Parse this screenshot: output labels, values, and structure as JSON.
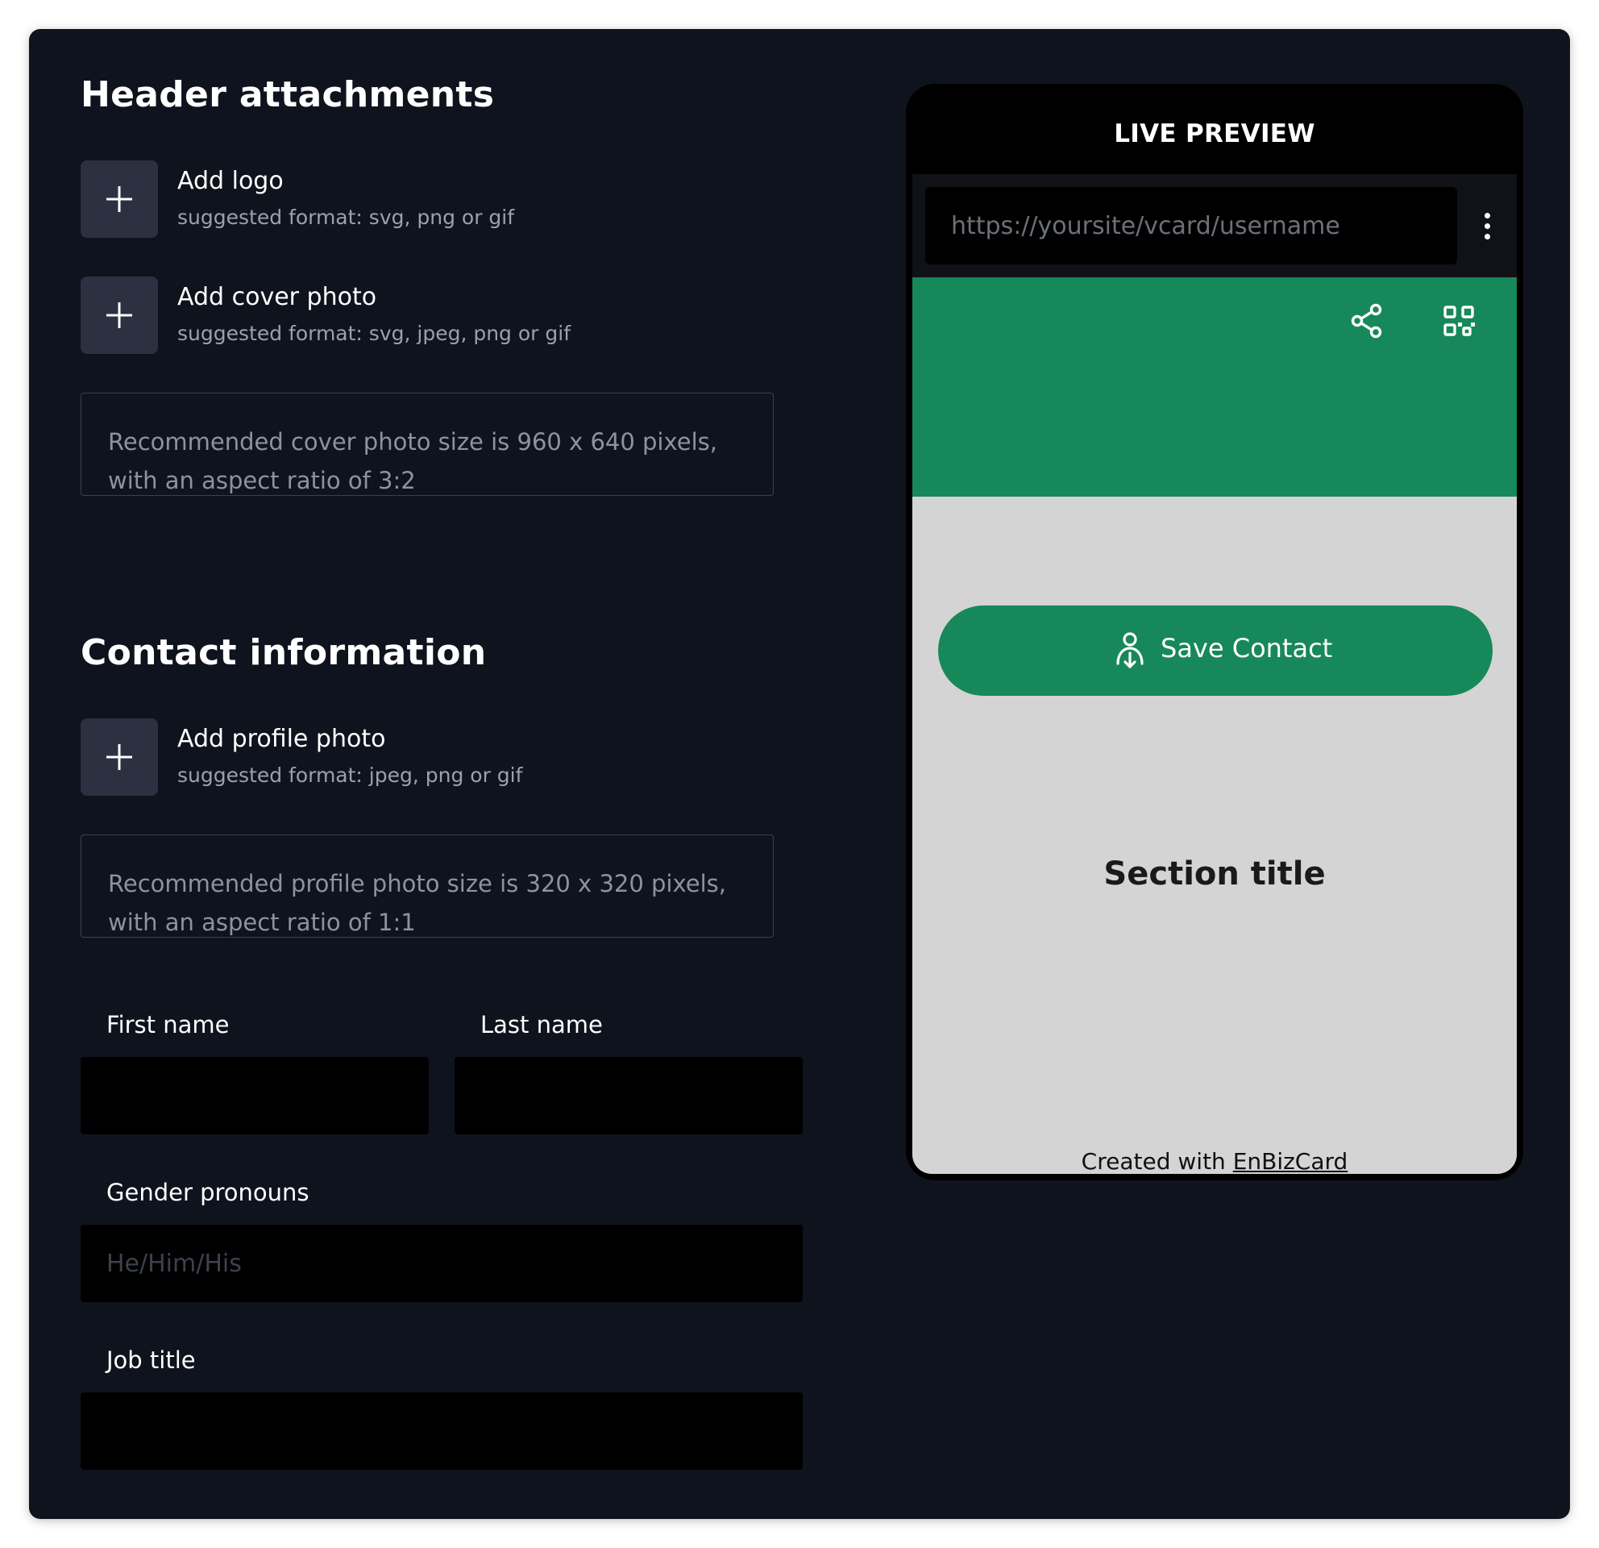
{
  "header_attachments": {
    "title": "Header attachments",
    "logo": {
      "label": "Add logo",
      "hint": "suggested format: svg, png or gif"
    },
    "cover": {
      "label": "Add cover photo",
      "hint": "suggested format: svg, jpeg, png or gif"
    },
    "cover_note": "Recommended cover photo size is 960 x 640 pixels, with an aspect ratio of 3:2"
  },
  "contact_information": {
    "title": "Contact information",
    "profile": {
      "label": "Add profile photo",
      "hint": "suggested format: jpeg, png or gif"
    },
    "profile_note": "Recommended profile photo size is 320 x 320 pixels, with an aspect ratio of 1:1",
    "first_name": {
      "label": "First name",
      "value": ""
    },
    "last_name": {
      "label": "Last name",
      "value": ""
    },
    "gender_pronouns": {
      "label": "Gender pronouns",
      "placeholder": "He/Him/His",
      "value": ""
    },
    "job_title": {
      "label": "Job title",
      "value": ""
    }
  },
  "preview": {
    "title": "LIVE PREVIEW",
    "url_placeholder": "https://yoursite/vcard/username",
    "save_contact": "Save Contact",
    "section_title": "Section title",
    "credit_prefix": "Created with ",
    "credit_link": "EnBizCard",
    "icons": [
      "share-icon",
      "qr-code-icon",
      "more-vertical-icon",
      "contact-download-icon"
    ]
  },
  "colors": {
    "panel_bg": "#0f131d",
    "accent_green": "#17885a",
    "preview_bg": "#d4d4d4"
  }
}
